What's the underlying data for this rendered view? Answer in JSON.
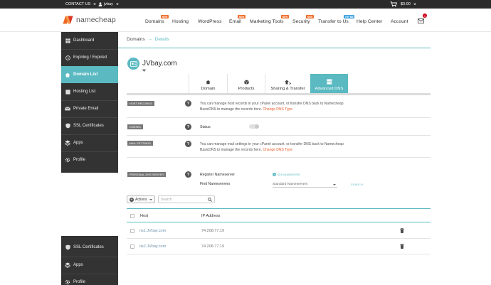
{
  "topbar": {
    "contact": "CONTACT US",
    "user": "jvbay",
    "cart": "$0.00"
  },
  "header": {
    "logo_text": "namecheap",
    "nav": [
      {
        "label": "Domains",
        "badge": "NEW"
      },
      {
        "label": "Hosting",
        "badge": ""
      },
      {
        "label": "WordPress",
        "badge": ""
      },
      {
        "label": "Email",
        "badge": "NEW"
      },
      {
        "label": "Marketing Tools",
        "badge": "NEW"
      },
      {
        "label": "Security",
        "badge": "NEW"
      },
      {
        "label": "Transfer to Us",
        "badge": "TRY ME"
      },
      {
        "label": "Help Center",
        "badge": ""
      },
      {
        "label": "Account",
        "badge": ""
      }
    ],
    "mail_count": "1"
  },
  "sidebar": {
    "items": [
      {
        "label": "Dashboard"
      },
      {
        "label": "Expiring / Expired"
      },
      {
        "label": "Domain List"
      },
      {
        "label": "Hosting List"
      },
      {
        "label": "Private Email"
      },
      {
        "label": "SSL Certificates"
      },
      {
        "label": "Apps"
      },
      {
        "label": "Profile"
      }
    ],
    "bottom_items": [
      {
        "label": "SSL Certificates"
      },
      {
        "label": "Apps"
      },
      {
        "label": "Profile"
      }
    ]
  },
  "breadcrumb": {
    "root": "Domains",
    "sep": "→",
    "current": "Details"
  },
  "domain": {
    "name": "JVbay.com"
  },
  "tabs": [
    {
      "label": "Domain"
    },
    {
      "label": "Products"
    },
    {
      "label": "Sharing & Transfer"
    },
    {
      "label": "Advanced DNS"
    }
  ],
  "sections": {
    "host_records": {
      "label": "HOST RECORDS",
      "line1": "You can manage host records in your cPanel account, or transfer DNS back to Namecheap",
      "line2": "BasicDNS to manage the records here.",
      "link": "Change DNS Type"
    },
    "dnssec": {
      "label": "DNSSEC",
      "status_label": "Status"
    },
    "mail_settings": {
      "label": "MAIL SETTINGS",
      "line1": "You can manage mail settings in your cPanel account, or transfer DNS back to Namecheap",
      "line2": "BasicDNS to manage the records here.",
      "link": "Change DNS Type"
    },
    "personal_dns": {
      "label": "PERSONAL DNS SERVER",
      "register_label": "Register Nameserver",
      "add_label": "ADD NAMESERVER",
      "find_label": "Find Nameservers",
      "select_value": "Standard Nameservers",
      "search_label": "SEARCH"
    }
  },
  "toolbar": {
    "actions_label": "Actions",
    "search_placeholder": "Search"
  },
  "table": {
    "headers": {
      "host": "Host",
      "ip": "IP Address"
    },
    "rows": [
      {
        "host": "ns1.JVbay.com",
        "ip": "74.208.77.19"
      },
      {
        "host": "ns2.JVbay.com",
        "ip": "74.208.77.19"
      }
    ]
  },
  "colors": {
    "accent": "#5ab9c1",
    "brand_orange": "#f06a24",
    "sidebar_bg": "#333333",
    "topbar_bg": "#2b2b2b",
    "link": "#e85a2a"
  }
}
